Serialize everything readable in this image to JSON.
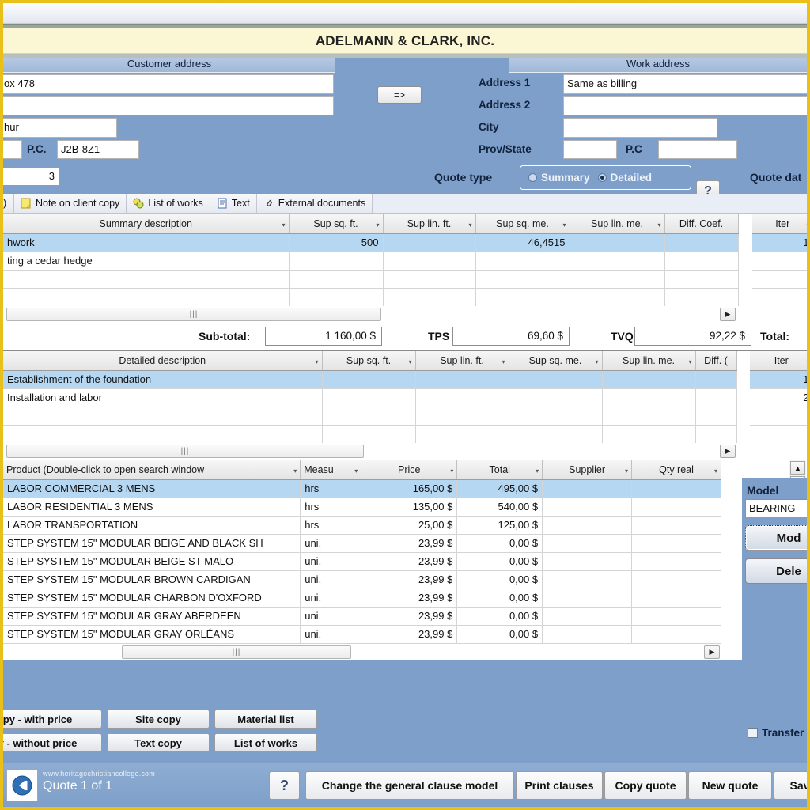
{
  "window": {
    "title": "ADELMANN & CLARK, INC."
  },
  "address": {
    "customer_header": "Customer address",
    "work_header": "Work address",
    "customer": {
      "line1": "ox 478",
      "line2": "",
      "city": "hur",
      "pc_label": "P.C.",
      "postal_code": "J2B-8Z1"
    },
    "copy_button": "=>",
    "work": {
      "address1_label": "Address 1",
      "address1_value": "Same as billing",
      "address2_label": "Address 2",
      "address2_value": "",
      "city_label": "City",
      "city_value": "",
      "prov_label": "Prov/State",
      "prov_value": "",
      "pc_label": "P.C",
      "pc_value": ""
    }
  },
  "quote_bar": {
    "number_value": "3",
    "quote_type_label": "Quote type",
    "options": [
      {
        "label": "Summary",
        "selected": false
      },
      {
        "label": "Detailed",
        "selected": true
      }
    ],
    "help_icon": "question-icon",
    "quote_date_label": "Quote dat"
  },
  "tabs": [
    {
      "label": ")",
      "icon": ""
    },
    {
      "label": "Note on client copy",
      "icon": "note-icon"
    },
    {
      "label": "List of works",
      "icon": "works-icon"
    },
    {
      "label": "Text",
      "icon": "text-document-icon"
    },
    {
      "label": "External documents",
      "icon": "paperclip-icon"
    }
  ],
  "summary_grid": {
    "columns": [
      "Summary description",
      "Sup sq. ft.",
      "Sup lin. ft.",
      "Sup sq. me.",
      "Sup lin. me.",
      "Diff. Coef."
    ],
    "side_column": "Iter",
    "rows": [
      {
        "cells": [
          "hwork",
          "500",
          "",
          "46,4515",
          "",
          ""
        ],
        "item": "1",
        "selected": true
      },
      {
        "cells": [
          "ting a cedar hedge",
          "",
          "",
          "",
          "",
          ""
        ],
        "item": "",
        "selected": false
      },
      {
        "cells": [
          "",
          "",
          "",
          "",
          "",
          ""
        ],
        "item": "",
        "selected": false
      },
      {
        "cells": [
          "",
          "",
          "",
          "",
          "",
          ""
        ],
        "item": "",
        "selected": false
      }
    ]
  },
  "totals": {
    "subtotal_label": "Sub-total:",
    "subtotal_value": "1 160,00 $",
    "tps_label": "TPS",
    "tps_value": "69,60 $",
    "tvq_label": "TVQ",
    "tvq_value": "92,22 $",
    "total_label": "Total:"
  },
  "detail_grid": {
    "columns": [
      "Detailed description",
      "Sup sq. ft.",
      "Sup lin. ft.",
      "Sup sq. me.",
      "Sup lin. me.",
      "Diff. ("
    ],
    "side_column": "Iter",
    "rows": [
      {
        "cells": [
          "Establishment of the foundation",
          "",
          "",
          "",
          "",
          ""
        ],
        "item": "1",
        "selected": true
      },
      {
        "cells": [
          "Installation and labor",
          "",
          "",
          "",
          "",
          ""
        ],
        "item": "2",
        "selected": false
      },
      {
        "cells": [
          "",
          "",
          "",
          "",
          "",
          ""
        ],
        "item": "",
        "selected": false
      },
      {
        "cells": [
          "",
          "",
          "",
          "",
          "",
          ""
        ],
        "item": "",
        "selected": false
      }
    ]
  },
  "product_grid": {
    "columns": [
      "Product (Double-click to open search window",
      "Measu",
      "Price",
      "Total",
      "Supplier",
      "Qty real"
    ],
    "rows": [
      {
        "product": "LABOR COMMERCIAL 3 MENS",
        "measure": "hrs",
        "price": "165,00 $",
        "total": "495,00 $",
        "supplier": "",
        "qty_real": "",
        "selected": true
      },
      {
        "product": "LABOR RESIDENTIAL 3 MENS",
        "measure": "hrs",
        "price": "135,00 $",
        "total": "540,00 $",
        "supplier": "",
        "qty_real": "",
        "selected": false
      },
      {
        "product": "LABOR TRANSPORTATION",
        "measure": "hrs",
        "price": "25,00 $",
        "total": "125,00 $",
        "supplier": "",
        "qty_real": "",
        "selected": false
      },
      {
        "product": "STEP SYSTEM 15\" MODULAR BEIGE AND BLACK SH",
        "measure": "uni.",
        "price": "23,99 $",
        "total": "0,00 $",
        "supplier": "",
        "qty_real": "",
        "selected": false
      },
      {
        "product": "STEP SYSTEM 15\" MODULAR BEIGE ST-MALO",
        "measure": "uni.",
        "price": "23,99 $",
        "total": "0,00 $",
        "supplier": "",
        "qty_real": "",
        "selected": false
      },
      {
        "product": "STEP SYSTEM 15\" MODULAR BROWN CARDIGAN",
        "measure": "uni.",
        "price": "23,99 $",
        "total": "0,00 $",
        "supplier": "",
        "qty_real": "",
        "selected": false
      },
      {
        "product": "STEP SYSTEM 15\" MODULAR CHARBON D'OXFORD",
        "measure": "uni.",
        "price": "23,99 $",
        "total": "0,00 $",
        "supplier": "",
        "qty_real": "",
        "selected": false
      },
      {
        "product": "STEP SYSTEM 15\" MODULAR GRAY ABERDEEN",
        "measure": "uni.",
        "price": "23,99 $",
        "total": "0,00 $",
        "supplier": "",
        "qty_real": "",
        "selected": false
      },
      {
        "product": "STEP SYSTEM 15\" MODULAR GRAY ORLÉANS",
        "measure": "uni.",
        "price": "23,99 $",
        "total": "0,00 $",
        "supplier": "",
        "qty_real": "",
        "selected": false
      }
    ]
  },
  "model_panel": {
    "title": "Model",
    "value": "BEARING",
    "model_button": "Mod",
    "delete_button": "Dele"
  },
  "actions": {
    "buttons": [
      "py - with price",
      "Site copy",
      "Material list",
      "y - without price",
      "Text copy",
      "List of works"
    ],
    "transfer_checkbox": "Transfer",
    "transfer_checked": false
  },
  "status_bar": {
    "nav_icon": "previous-record-icon",
    "watermark": "www.heritagechristiancollege.com",
    "quote_count": "Quote 1 of 1",
    "help_icon": "question-icon",
    "buttons": [
      "Change the general clause model",
      "Print clauses",
      "Copy quote",
      "New quote",
      "Sav"
    ]
  },
  "colors": {
    "frame": "#e8c019",
    "panel_blue": "#7d9fc9",
    "title_bg": "#fbf7d4",
    "selection": "#b6d7f2"
  }
}
